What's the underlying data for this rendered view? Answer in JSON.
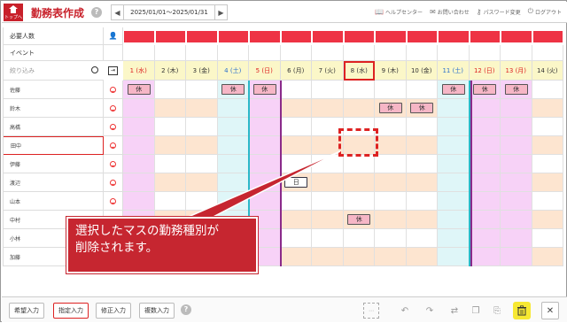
{
  "header": {
    "top_label": "トップへ",
    "title": "勤務表作成",
    "help_glyph": "?",
    "date_range": "2025/01/01～2025/01/31",
    "prev_arrow": "◀",
    "next_arrow": "▶",
    "links": [
      {
        "label": "ヘルプセンター",
        "icon": "book-icon"
      },
      {
        "label": "お問い合わせ",
        "icon": "mail-icon"
      },
      {
        "label": "パスワード変更",
        "icon": "key-icon"
      },
      {
        "label": "ログアウト",
        "icon": "logout-icon"
      }
    ]
  },
  "grid": {
    "required_label": "必要人数",
    "event_label": "イベント",
    "filter_placeholder": "絞り込み",
    "dates": [
      {
        "label": "1 (水)",
        "color": "red"
      },
      {
        "label": "2 (木)",
        "color": "normal"
      },
      {
        "label": "3 (金)",
        "color": "normal"
      },
      {
        "label": "4 (土)",
        "color": "blue"
      },
      {
        "label": "5 (日)",
        "color": "red"
      },
      {
        "label": "6 (月)",
        "color": "normal"
      },
      {
        "label": "7 (火)",
        "color": "normal"
      },
      {
        "label": "8 (水)",
        "color": "normal",
        "selected": true
      },
      {
        "label": "9 (木)",
        "color": "normal"
      },
      {
        "label": "10 (金)",
        "color": "normal"
      },
      {
        "label": "11 (土)",
        "color": "blue"
      },
      {
        "label": "12 (日)",
        "color": "red"
      },
      {
        "label": "13 (月)",
        "color": "red"
      },
      {
        "label": "14 (火)",
        "color": "normal"
      }
    ],
    "staff": [
      {
        "name": "佐藤",
        "shifts": {
          "0": "休",
          "3": "休",
          "4": "休",
          "10": "休",
          "11": "休",
          "12": "休"
        }
      },
      {
        "name": "鈴木",
        "shifts": {
          "8": "休",
          "9": "休"
        }
      },
      {
        "name": "高橋",
        "shifts": {}
      },
      {
        "name": "田中",
        "shifts": {},
        "selected": true
      },
      {
        "name": "伊藤",
        "shifts": {}
      },
      {
        "name": "渡辺",
        "shifts": {
          "5": "日"
        }
      },
      {
        "name": "山本",
        "shifts": {}
      },
      {
        "name": "中村",
        "shifts": {
          "7": "休"
        }
      },
      {
        "name": "小林",
        "shifts": {}
      },
      {
        "name": "加藤",
        "shifts": {}
      }
    ]
  },
  "callout": {
    "line1": "選択したマスの勤務種別が",
    "line2": "削除されます。"
  },
  "footer": {
    "buttons": [
      {
        "label": "希望入力",
        "active": false
      },
      {
        "label": "指定入力",
        "active": true
      },
      {
        "label": "修正入力",
        "active": false
      },
      {
        "label": "複数入力",
        "active": false
      }
    ],
    "help_glyph": "?",
    "close_glyph": "✕"
  }
}
